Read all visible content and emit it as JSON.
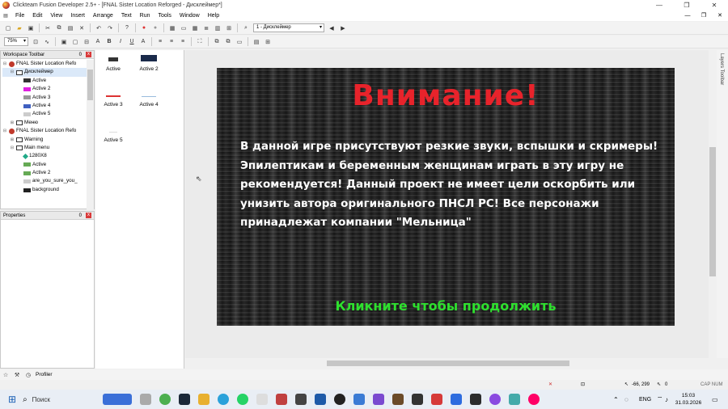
{
  "window": {
    "title": "Clickteam Fusion Developer 2.5+ - [FNAL Sister Location Reforged - Дисклеймер*]",
    "controls": [
      "—",
      "❐",
      "✕"
    ]
  },
  "menu": [
    "File",
    "Edit",
    "View",
    "Insert",
    "Arrange",
    "Text",
    "Run",
    "Tools",
    "Window",
    "Help"
  ],
  "mdi_controls": [
    "—",
    "❐",
    "✕"
  ],
  "toolbar": {
    "frame_select": "1 - Дисклеймер",
    "zoom": "75%"
  },
  "workspace": {
    "title": "Workspace Toolbar",
    "tree": [
      {
        "label": "FNAL Sister Location Refo",
        "indent": 0,
        "icon": "app-icon",
        "exp": "⊟"
      },
      {
        "label": "Дисклеймер",
        "indent": 1,
        "icon": "frame-icon",
        "exp": "⊟",
        "selected": true
      },
      {
        "label": "Active",
        "indent": 2,
        "icon": "active-dark-icon",
        "color": "#333"
      },
      {
        "label": "Active 2",
        "indent": 2,
        "icon": "active-magenta-icon",
        "color": "#e020e0"
      },
      {
        "label": "Active 3",
        "indent": 2,
        "icon": "active-dash-icon",
        "color": "#999"
      },
      {
        "label": "Active 4",
        "indent": 2,
        "icon": "active-blue-icon",
        "color": "#4060c0"
      },
      {
        "label": "Active 5",
        "indent": 2,
        "icon": "active-light-icon",
        "color": "#ccc"
      },
      {
        "label": "Меню",
        "indent": 1,
        "icon": "frame-icon",
        "exp": "⊞"
      },
      {
        "label": "FNAL Sister Location Refo",
        "indent": 0,
        "icon": "app-icon",
        "exp": "⊟"
      },
      {
        "label": "Warning",
        "indent": 1,
        "icon": "frame-icon",
        "exp": "⊞"
      },
      {
        "label": "Main menu",
        "indent": 1,
        "icon": "frame-icon",
        "exp": "⊟"
      },
      {
        "label": "1280X8",
        "indent": 2,
        "icon": "diamond-icon",
        "color": "#2a8"
      },
      {
        "label": "Active",
        "indent": 2,
        "icon": "active-green-icon",
        "color": "#6a5"
      },
      {
        "label": "Active 2",
        "indent": 2,
        "icon": "active-green-icon",
        "color": "#6a5"
      },
      {
        "label": "are_you_sure_you_",
        "indent": 2,
        "icon": "active-light-icon",
        "color": "#ccc"
      },
      {
        "label": "background",
        "indent": 2,
        "icon": "active-dark-icon",
        "color": "#222"
      }
    ]
  },
  "properties": {
    "title": "Properties"
  },
  "pin": "0",
  "close": "x",
  "objects": [
    {
      "label": "Active",
      "color": "#333"
    },
    {
      "label": "Active 2",
      "color": "#1a2a4a"
    },
    {
      "label": "Active 3",
      "color": "#d33"
    },
    {
      "label": "Active 4",
      "color": "#9bd"
    },
    {
      "label": "Active 5",
      "color": "#ddd"
    }
  ],
  "game": {
    "title": "Внимание!",
    "text": "В данной игре присутствуют резкие звуки, вспышки и скримеры! Эпилептикам и беременным женщинам играть в эту игру не рекомендуется! Данный проект не имеет цели оскорбить или унизить автора оригинального ПНСЛ РС! Все персонажи принадлежат компании \"Мельница\"",
    "click": "Кликните чтобы продолжить"
  },
  "right_tab": "Layers Toolbar",
  "bottom": {
    "profiler": "Profiler"
  },
  "status": {
    "coords": "-66, 299",
    "objects": "0",
    "caps": "CAP NUM"
  },
  "taskbar": {
    "search": "Поиск",
    "time": "15:03",
    "date": "31.03.2026",
    "lang": "ENG"
  }
}
